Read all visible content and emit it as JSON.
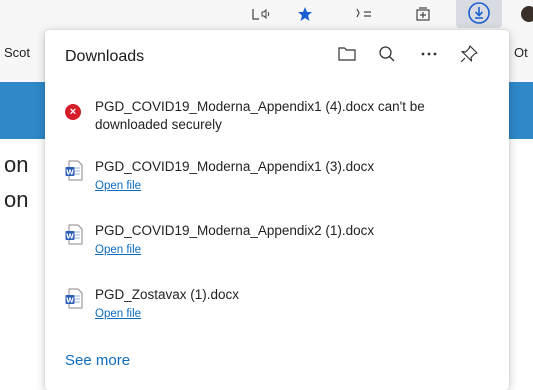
{
  "toolbar": {
    "read_aloud_icon": "read-aloud-icon",
    "favorite_icon": "star-icon",
    "favorites_list_icon": "favorites-list-icon",
    "collections_icon": "collections-icon",
    "downloads_icon": "download-icon",
    "profile_icon": "avatar"
  },
  "favorites_bar": {
    "left_label": "Scot",
    "right_label": "Ot"
  },
  "page": {
    "text_line1": "on",
    "text_line2": "on",
    "banner_color": "#2f88c8"
  },
  "downloads": {
    "title": "Downloads",
    "actions": [
      "folder-icon",
      "search-icon",
      "more-icon",
      "pin-icon"
    ],
    "items": [
      {
        "filename": "PGD_COVID19_Moderna_Appendix1 (4).docx can't be downloaded securely",
        "status": "error",
        "icon": "error-icon"
      },
      {
        "filename": "PGD_COVID19_Moderna_Appendix1 (3).docx",
        "action": "Open file",
        "icon": "word-doc-icon"
      },
      {
        "filename": "PGD_COVID19_Moderna_Appendix2 (1).docx",
        "action": "Open file",
        "icon": "word-doc-icon"
      },
      {
        "filename": "PGD_Zostavax (1).docx",
        "action": "Open file",
        "icon": "word-doc-icon"
      }
    ],
    "see_more": "See more"
  },
  "colors": {
    "accent_link": "#0f6cbd",
    "error_red": "#d61e2b",
    "star_blue": "#1a5fd1"
  }
}
